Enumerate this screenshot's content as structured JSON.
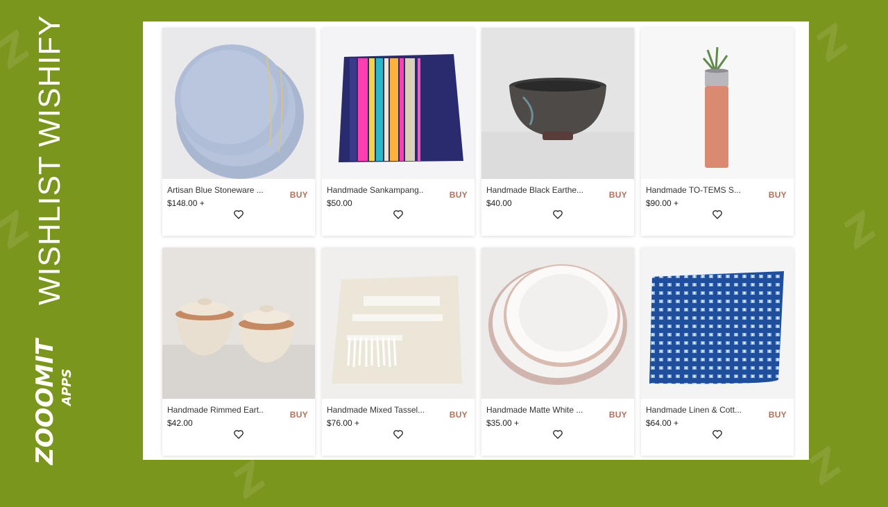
{
  "banner": {
    "title": "WISHLIST WISHIFY",
    "logo_text": "ZOOOMIT APPS",
    "background_color": "#7b961c"
  },
  "products": [
    {
      "title": "Artisan Blue Stoneware ...",
      "price": "$148.00 +",
      "buy_label": "BUY",
      "image": "blue-stoneware-plates"
    },
    {
      "title": "Handmade Sankampang...",
      "price": "$50.00",
      "buy_label": "BUY",
      "image": "striped-cushion"
    },
    {
      "title": "Handmade Black Earthe...",
      "price": "$40.00",
      "buy_label": "BUY",
      "image": "black-earthen-bowl"
    },
    {
      "title": "Handmade TO-TEMS S...",
      "price": "$90.00 +",
      "buy_label": "BUY",
      "image": "wooden-vase-plant"
    },
    {
      "title": "Handmade Rimmed Eart...",
      "price": "$42.00",
      "buy_label": "BUY",
      "image": "rimmed-earthen-pots"
    },
    {
      "title": "Handmade Mixed Tassel...",
      "price": "$76.00 +",
      "buy_label": "BUY",
      "image": "tassel-cushion"
    },
    {
      "title": "Handmade Matte White ...",
      "price": "$35.00 +",
      "buy_label": "BUY",
      "image": "matte-white-plates"
    },
    {
      "title": "Handmade Linen & Cott...",
      "price": "$64.00 +",
      "buy_label": "BUY",
      "image": "blue-linen-cushion"
    }
  ],
  "colors": {
    "buy": "#b07059",
    "accent_green": "#7b961c"
  },
  "icons": {
    "wishlist": "heart-outline-icon"
  }
}
